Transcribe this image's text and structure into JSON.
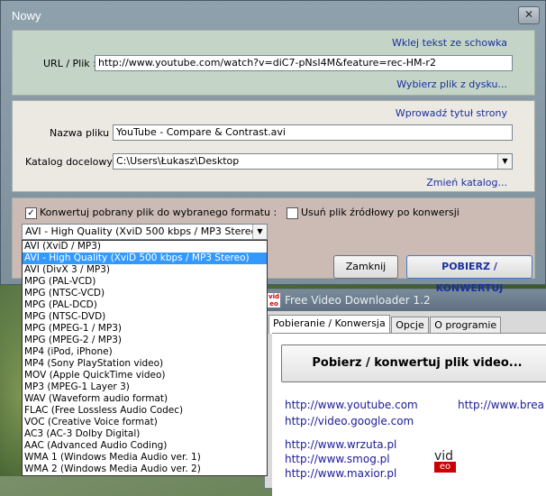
{
  "dialog": {
    "title": "Nowy",
    "close_symbol": "✕",
    "url_section": {
      "paste_link": "Wklej tekst ze schowka",
      "url_label": "URL / Plik :",
      "url_value": "http://www.youtube.com/watch?v=diC7-pNsI4M&feature=rec-HM-r2",
      "choose_file_link": "Wybierz plik z dysku..."
    },
    "file_section": {
      "enter_title_link": "Wprowadź tytuł strony",
      "filename_label": "Nazwa pliku :",
      "filename_value": "YouTube - Compare & Contrast.avi",
      "folder_label": "Katalog docelowy :",
      "folder_value": "C:\\Users\\Łukasz\\Desktop",
      "change_folder_link": "Zmień katalog..."
    },
    "conversion_section": {
      "convert_checkbox_label": "Konwertuj pobrany plik do wybranego formatu :",
      "convert_checked": true,
      "delete_checkbox_label": "Usuń plik źródłowy po konwersji",
      "delete_checked": false,
      "format_selected": "AVI - High Quality  (XviD 500 kbps / MP3 Stereo)",
      "close_button": "Zamknij",
      "download_button": "POBIERZ / KONWERTUJ"
    }
  },
  "format_dropdown": {
    "selected_index": 1,
    "options": [
      "AVI  (XviD / MP3)",
      "AVI - High Quality  (XviD 500 kbps / MP3 Stereo)",
      "AVI  (DivX 3 / MP3)",
      "MPG  (PAL-VCD)",
      "MPG  (NTSC-VCD)",
      "MPG  (PAL-DCD)",
      "MPG  (NTSC-DVD)",
      "MPG  (MPEG-1 / MP3)",
      "MPG  (MPEG-2 / MP3)",
      "MP4  (iPod, iPhone)",
      "MP4  (Sony PlayStation video)",
      "MOV  (Apple QuickTime video)",
      "MP3  (MPEG-1 Layer 3)",
      "WAV  (Waveform audio format)",
      "FLAC  (Free Lossless Audio Codec)",
      "VOC  (Creative Voice format)",
      "AC3  (AC-3 Dolby Digital)",
      "AAC  (Advanced Audio Coding)",
      "WMA 1  (Windows Media Audio ver. 1)",
      "WMA 2  (Windows Media Audio ver. 2)"
    ]
  },
  "background_window": {
    "logo_top": "vid",
    "logo_bottom": "eo",
    "title": "Free Video Downloader 1.2",
    "tabs": [
      "Pobieranie / Konwersja",
      "Opcje",
      "O programie"
    ],
    "main_button": "Pobierz / konwertuj plik video...",
    "links": [
      "http://www.youtube.com",
      "http://video.google.com",
      "http://www.wrzuta.pl",
      "http://www.smog.pl",
      "http://www.maxior.pl",
      "http://www.brea"
    ]
  }
}
